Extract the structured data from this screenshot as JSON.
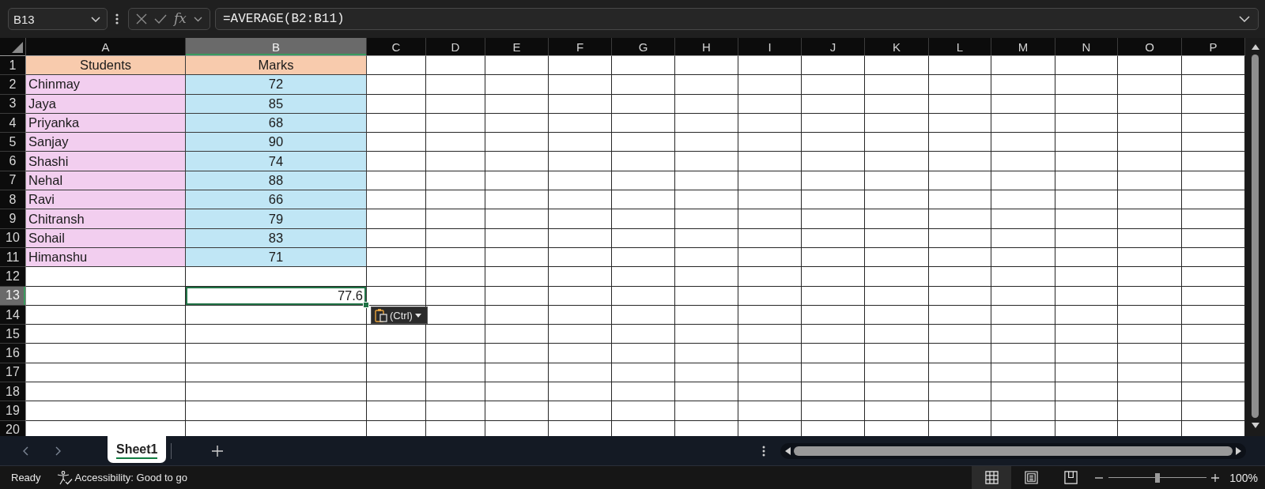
{
  "formula_bar": {
    "name_box": "B13",
    "function_label": "fx",
    "formula": "=AVERAGE(B2:B11)"
  },
  "grid": {
    "columns": [
      {
        "label": "A",
        "selected": false
      },
      {
        "label": "B",
        "selected": true
      },
      {
        "label": "C",
        "selected": false
      },
      {
        "label": "D",
        "selected": false
      },
      {
        "label": "E",
        "selected": false
      },
      {
        "label": "F",
        "selected": false
      },
      {
        "label": "G",
        "selected": false
      },
      {
        "label": "H",
        "selected": false
      },
      {
        "label": "I",
        "selected": false
      },
      {
        "label": "J",
        "selected": false
      },
      {
        "label": "K",
        "selected": false
      },
      {
        "label": "L",
        "selected": false
      },
      {
        "label": "M",
        "selected": false
      },
      {
        "label": "N",
        "selected": false
      },
      {
        "label": "O",
        "selected": false
      },
      {
        "label": "P",
        "selected": false
      }
    ],
    "rows": [
      {
        "label": "1",
        "selected": false,
        "cells": [
          {
            "text": "Students",
            "kind": "heading",
            "color": "#f8cbad",
            "selected": false
          },
          {
            "text": "Marks",
            "kind": "heading",
            "color": "#f8cbad",
            "selected": false
          }
        ]
      },
      {
        "label": "2",
        "selected": false,
        "cells": [
          {
            "text": "Chinmay",
            "kind": "text",
            "color": "#f2ceef",
            "selected": false
          },
          {
            "text": "72",
            "kind": "number",
            "color": "#c0e6f5",
            "selected": false
          }
        ]
      },
      {
        "label": "3",
        "selected": false,
        "cells": [
          {
            "text": "Jaya",
            "kind": "text",
            "color": "#f2ceef",
            "selected": false
          },
          {
            "text": "85",
            "kind": "number",
            "color": "#c0e6f5",
            "selected": false
          }
        ]
      },
      {
        "label": "4",
        "selected": false,
        "cells": [
          {
            "text": "Priyanka",
            "kind": "text",
            "color": "#f2ceef",
            "selected": false
          },
          {
            "text": "68",
            "kind": "number",
            "color": "#c0e6f5",
            "selected": false
          }
        ]
      },
      {
        "label": "5",
        "selected": false,
        "cells": [
          {
            "text": "Sanjay",
            "kind": "text",
            "color": "#f2ceef",
            "selected": false
          },
          {
            "text": "90",
            "kind": "number",
            "color": "#c0e6f5",
            "selected": false
          }
        ]
      },
      {
        "label": "6",
        "selected": false,
        "cells": [
          {
            "text": "Shashi",
            "kind": "text",
            "color": "#f2ceef",
            "selected": false
          },
          {
            "text": "74",
            "kind": "number",
            "color": "#c0e6f5",
            "selected": false
          }
        ]
      },
      {
        "label": "7",
        "selected": false,
        "cells": [
          {
            "text": "Nehal",
            "kind": "text",
            "color": "#f2ceef",
            "selected": false
          },
          {
            "text": "88",
            "kind": "number",
            "color": "#c0e6f5",
            "selected": false
          }
        ]
      },
      {
        "label": "8",
        "selected": false,
        "cells": [
          {
            "text": "Ravi",
            "kind": "text",
            "color": "#f2ceef",
            "selected": false
          },
          {
            "text": "66",
            "kind": "number",
            "color": "#c0e6f5",
            "selected": false
          }
        ]
      },
      {
        "label": "9",
        "selected": false,
        "cells": [
          {
            "text": "Chitransh",
            "kind": "text",
            "color": "#f2ceef",
            "selected": false
          },
          {
            "text": "79",
            "kind": "number",
            "color": "#c0e6f5",
            "selected": false
          }
        ]
      },
      {
        "label": "10",
        "selected": false,
        "cells": [
          {
            "text": "Sohail",
            "kind": "text",
            "color": "#f2ceef",
            "selected": false
          },
          {
            "text": "83",
            "kind": "number",
            "color": "#c0e6f5",
            "selected": false
          }
        ]
      },
      {
        "label": "11",
        "selected": false,
        "cells": [
          {
            "text": "Himanshu",
            "kind": "text",
            "color": "#f2ceef",
            "selected": false
          },
          {
            "text": "71",
            "kind": "number",
            "color": "#c0e6f5",
            "selected": false
          }
        ]
      },
      {
        "label": "12",
        "selected": false
      },
      {
        "label": "13",
        "selected": true,
        "cells": [
          null,
          {
            "text": "77.6",
            "kind": "total",
            "selected": true
          }
        ]
      },
      {
        "label": "14",
        "selected": false
      },
      {
        "label": "15",
        "selected": false
      },
      {
        "label": "16",
        "selected": false
      },
      {
        "label": "17",
        "selected": false
      },
      {
        "label": "18",
        "selected": false
      },
      {
        "label": "19",
        "selected": false
      },
      {
        "label": "20",
        "selected": false
      }
    ]
  },
  "paste_options": {
    "label": "(Ctrl)"
  },
  "sheet_tabs": [
    {
      "label": "Sheet1",
      "selected": true
    }
  ],
  "status_bar": {
    "mode": "Ready",
    "accessibility": "Accessibility: Good to go",
    "views": [
      {
        "kind": "normal",
        "selected": true
      },
      {
        "kind": "page_layout",
        "selected": false
      },
      {
        "kind": "page_break_preview",
        "selected": false
      }
    ],
    "zoom": {
      "level": 0.5,
      "reading": "100%"
    }
  }
}
